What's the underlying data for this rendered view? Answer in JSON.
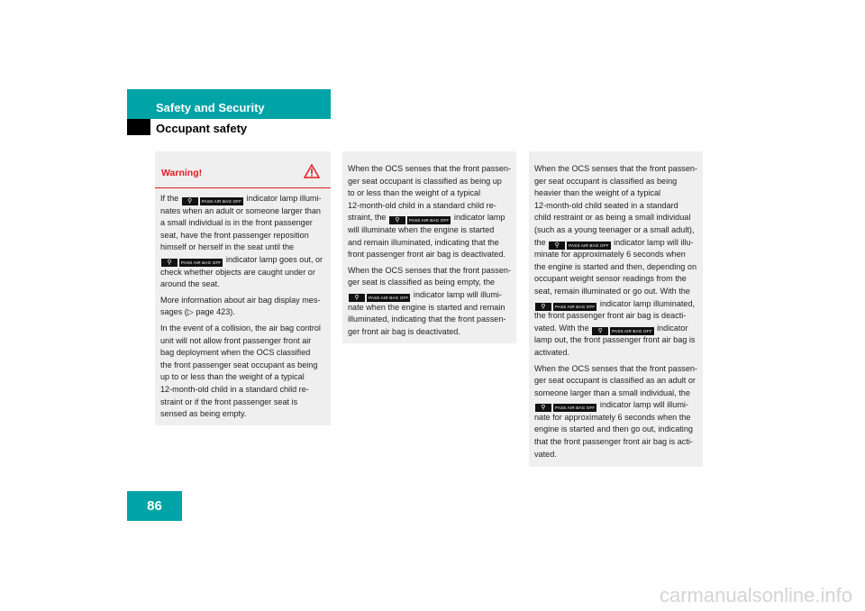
{
  "header": {
    "section": "Safety and Security",
    "subsection": "Occupant safety",
    "page_number": "86"
  },
  "indicator": {
    "icon": "passenger-airbag-off-indicator-icon",
    "label": "PASS AIR BAG OFF"
  },
  "colors": {
    "accent": "#00a3a6",
    "warning": "#e21a22",
    "box": "#efefef"
  },
  "warning": {
    "title": "Warning!",
    "icon": "warning-triangle-icon"
  },
  "columns": [
    {
      "paragraphs": [
        [
          "If the {icon} indicator lamp illumi-",
          "nates when an adult or someone larger than",
          "a small individual is in the front passenger",
          "seat, have the front passenger reposition",
          "himself or herself in the seat until the",
          "{icon} indicator lamp goes out, or",
          "check whether objects are caught under or",
          "around the seat."
        ],
        [
          "More information about air bag display mes-",
          "sages (▷ page 423)."
        ],
        [
          "In the event of a collision, the air bag control",
          "unit will not allow front passenger front air",
          "bag deployment when the OCS classified",
          "the front passenger seat occupant as being",
          "up to or less than the weight of a typical",
          " 12-month-old child in a standard child re-",
          "straint or if the front passenger seat is",
          "sensed as being empty."
        ]
      ]
    },
    {
      "paragraphs": [
        [
          "When the OCS senses that the front passen-",
          "ger seat occupant is classified as being up",
          "to or less than the weight of a typical",
          " 12-month-old child in a standard child re-",
          "straint, the {icon} indicator lamp",
          "will illuminate when the engine is started",
          "and remain illuminated, indicating that the",
          "front passenger front air bag is deactivated."
        ],
        [
          "When the OCS senses that the front passen-",
          "ger seat is classified as being empty, the",
          "{icon} indicator lamp will illumi-",
          "nate when the engine is started and remain",
          "illuminated, indicating that the front passen-",
          "ger front air bag is deactivated."
        ]
      ]
    },
    {
      "paragraphs": [
        [
          "When the OCS senses that the front passen-",
          "ger seat occupant is classified as being",
          "heavier than the weight of a typical",
          " 12-month-old child seated in a standard",
          "child restraint or as being a small individual",
          "(such as a young teenager or a small adult),",
          "the {icon} indicator lamp will illu-",
          "minate for approximately 6 seconds when",
          "the engine is started and then, depending on",
          "occupant weight sensor readings from the",
          "seat, remain illuminated or go out. With the",
          "{icon} indicator lamp illuminated,",
          "the front passenger front air bag is deacti-",
          "vated. With the {icon} indicator",
          "lamp out, the front passenger front air bag is",
          "activated."
        ],
        [
          "When the OCS senses that the front passen-",
          "ger seat occupant is classified as an adult or",
          "someone larger than a small individual, the",
          "{icon} indicator lamp will illumi-",
          "nate for approximately 6 seconds when the",
          "engine is started and then go out, indicating",
          "that the front passenger front air bag is acti-",
          "vated."
        ]
      ]
    }
  ],
  "watermark": "carmanualsonline.info"
}
